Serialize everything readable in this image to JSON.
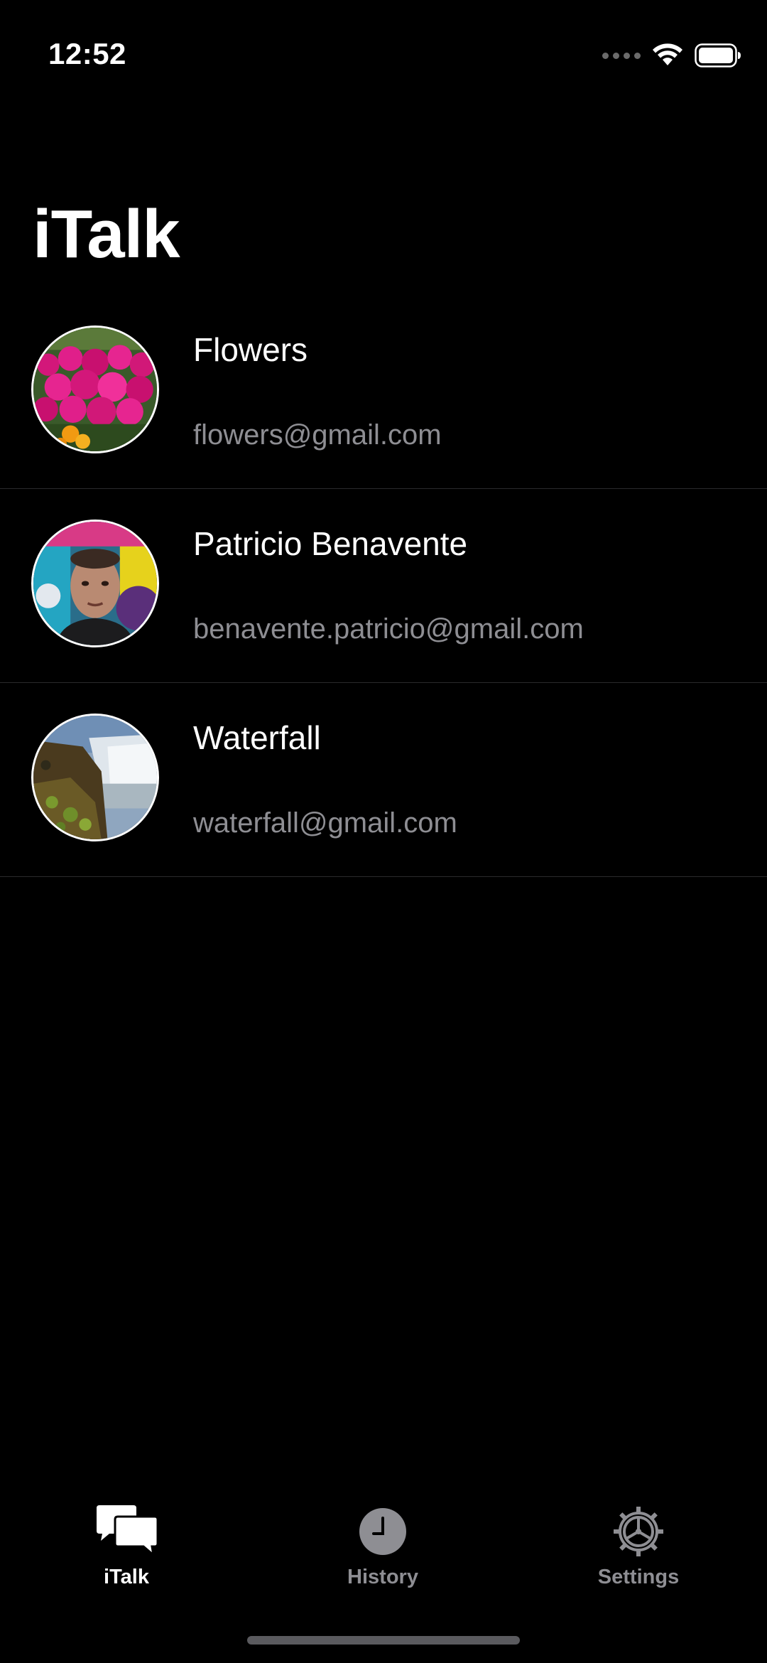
{
  "status_bar": {
    "time": "12:52"
  },
  "header": {
    "title": "iTalk"
  },
  "contacts": [
    {
      "name": "Flowers",
      "email": "flowers@gmail.com",
      "avatar": "flowers-photo"
    },
    {
      "name": "Patricio Benavente",
      "email": "benavente.patricio@gmail.com",
      "avatar": "person-photo"
    },
    {
      "name": "Waterfall",
      "email": "waterfall@gmail.com",
      "avatar": "waterfall-photo"
    }
  ],
  "tab_bar": {
    "tabs": [
      {
        "label": "iTalk",
        "icon": "chat-bubbles-icon",
        "active": true
      },
      {
        "label": "History",
        "icon": "clock-icon",
        "active": false
      },
      {
        "label": "Settings",
        "icon": "gear-icon",
        "active": false
      }
    ]
  },
  "colors": {
    "background": "#000000",
    "primary_text": "#ffffff",
    "secondary_text": "#8e8e93",
    "separator": "#2a2a2c"
  }
}
